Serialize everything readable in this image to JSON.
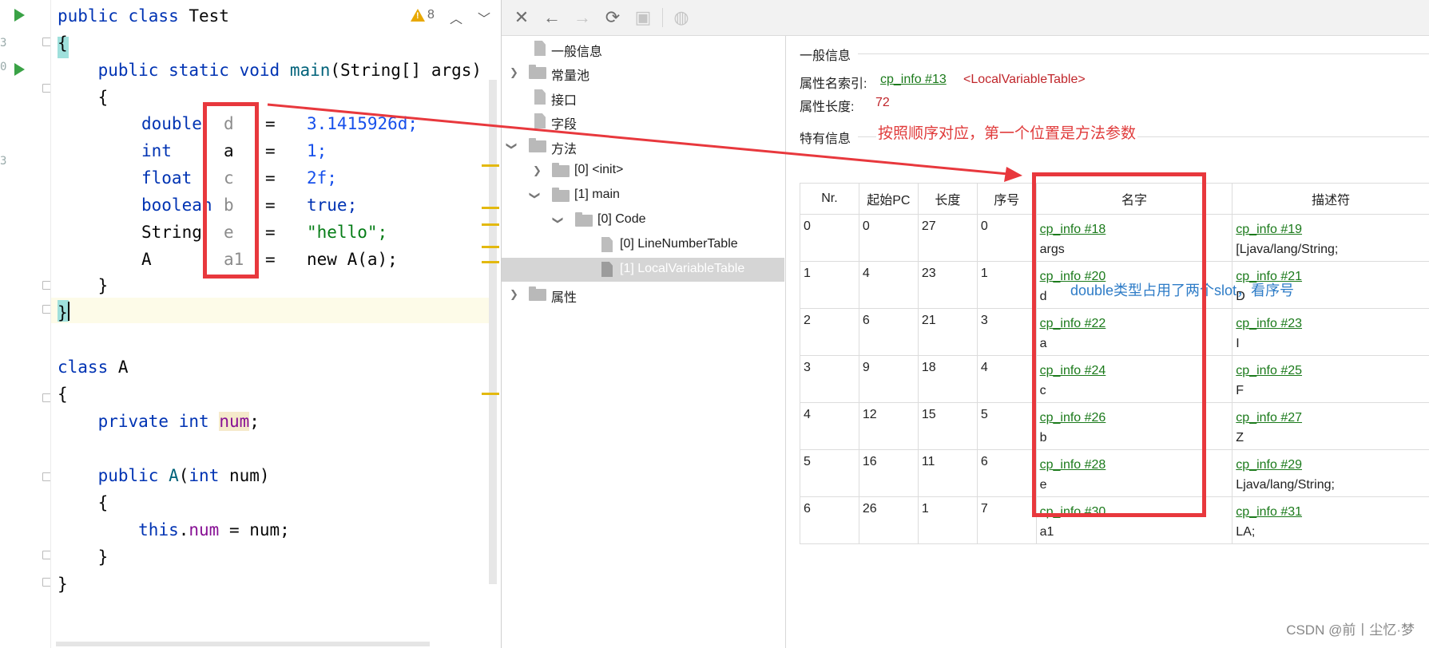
{
  "editor": {
    "line_numbers": [
      "3",
      "",
      "0",
      "",
      "",
      "",
      "3",
      "",
      "",
      "",
      "",
      "",
      "",
      "",
      "",
      "",
      "",
      "",
      "",
      "",
      "",
      "",
      "",
      "",
      ""
    ],
    "warning_count": "8",
    "code": {
      "l1": {
        "kw": "public class",
        "name": "Test"
      },
      "l2": "{",
      "l3": {
        "kw": "public static void",
        "fn": "main",
        "rest": "(String[] args)"
      },
      "l4": "{",
      "vars": [
        {
          "type": "double",
          "name": "d",
          "eq": "=",
          "val": "3.1415926d;"
        },
        {
          "type": "int",
          "name": "a",
          "eq": "=",
          "val": "1;"
        },
        {
          "type": "float",
          "name": "c",
          "eq": "=",
          "val": "2f;"
        },
        {
          "type": "boolean",
          "name": "b",
          "eq": "=",
          "val": "true;"
        },
        {
          "type": "String",
          "name": "e",
          "eq": "=",
          "val": "\"hello\";"
        },
        {
          "type": "A",
          "name": "a1",
          "eq": "=",
          "val": "new A(a);"
        }
      ],
      "l11": "}",
      "l12": "}",
      "l14": {
        "kw": "class",
        "name": "A"
      },
      "l15": "{",
      "l16": {
        "kw": "private int",
        "name": "num",
        "end": ";"
      },
      "l18": {
        "kw": "public",
        "fn": "A",
        "kw2": "int",
        "rest": "num)"
      },
      "l19": "{",
      "l20": {
        "kw": "this",
        "field": "num",
        "rest": " = num;"
      },
      "l21": "}",
      "l22": "}"
    }
  },
  "tree": {
    "items": [
      {
        "label": "一般信息"
      },
      {
        "label": "常量池"
      },
      {
        "label": "接口"
      },
      {
        "label": "字段"
      },
      {
        "label": "方法"
      },
      {
        "label": "[0] <init>"
      },
      {
        "label": "[1] main"
      },
      {
        "label": "[0] Code"
      },
      {
        "label": "[0] LineNumberTable"
      },
      {
        "label": "[1] LocalVariableTable"
      },
      {
        "label": "属性"
      }
    ]
  },
  "details": {
    "general_title": "一般信息",
    "name_index_label": "属性名索引:",
    "name_index_link": "cp_info #13",
    "name_index_value": "<LocalVariableTable>",
    "length_label": "属性长度:",
    "length_value": "72",
    "specific_title": "特有信息",
    "note_red": "按照顺序对应，第一个位置是方法参数",
    "note_blue": "double类型占用了两个slot，看序号",
    "table": {
      "headers": [
        "Nr.",
        "起始PC",
        "长度",
        "序号",
        "名字",
        "描述符"
      ],
      "rows": [
        {
          "nr": "0",
          "pc": "0",
          "len": "27",
          "idx": "0",
          "name_link": "cp_info #18",
          "name": "args",
          "desc_link": "cp_info #19",
          "desc": "[Ljava/lang/String;"
        },
        {
          "nr": "1",
          "pc": "4",
          "len": "23",
          "idx": "1",
          "name_link": "cp_info #20",
          "name": "d",
          "desc_link": "cp_info #21",
          "desc": "D"
        },
        {
          "nr": "2",
          "pc": "6",
          "len": "21",
          "idx": "3",
          "name_link": "cp_info #22",
          "name": "a",
          "desc_link": "cp_info #23",
          "desc": "I"
        },
        {
          "nr": "3",
          "pc": "9",
          "len": "18",
          "idx": "4",
          "name_link": "cp_info #24",
          "name": "c",
          "desc_link": "cp_info #25",
          "desc": "F"
        },
        {
          "nr": "4",
          "pc": "12",
          "len": "15",
          "idx": "5",
          "name_link": "cp_info #26",
          "name": "b",
          "desc_link": "cp_info #27",
          "desc": "Z"
        },
        {
          "nr": "5",
          "pc": "16",
          "len": "11",
          "idx": "6",
          "name_link": "cp_info #28",
          "name": "e",
          "desc_link": "cp_info #29",
          "desc": "Ljava/lang/String;"
        },
        {
          "nr": "6",
          "pc": "26",
          "len": "1",
          "idx": "7",
          "name_link": "cp_info #30",
          "name": "a1",
          "desc_link": "cp_info #31",
          "desc": "LA;"
        }
      ]
    }
  },
  "watermark": "CSDN @前丨尘忆·梦",
  "colors": {
    "annotation_red": "#e8383d",
    "link_green": "#1b7a1b",
    "keyword_blue": "#0033b3",
    "run_green": "#3aa246"
  }
}
